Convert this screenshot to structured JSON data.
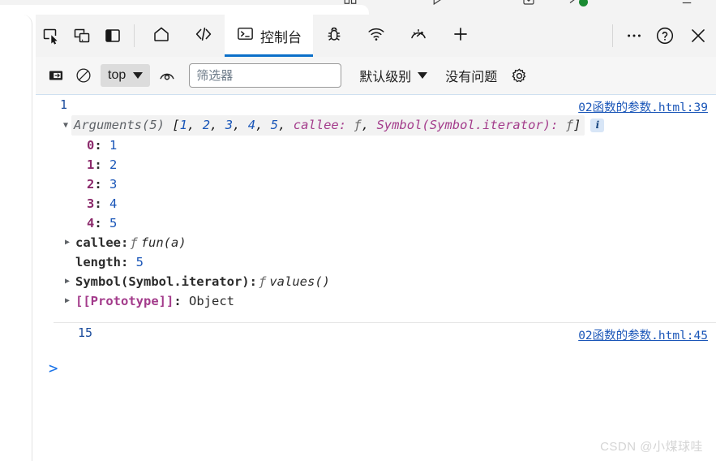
{
  "browser_chrome": {
    "icons": [
      "split-screen-icon",
      "play-icon",
      "download-icon",
      "extension-icon",
      "minimize-icon"
    ]
  },
  "devtools": {
    "toolbar_left_icons": [
      {
        "name": "inspect-element-icon"
      },
      {
        "name": "device-toolbar-icon"
      },
      {
        "name": "dock-side-icon"
      }
    ],
    "tabs": [
      {
        "name": "tab-home",
        "icon": "home-icon",
        "label": "",
        "active": false
      },
      {
        "name": "tab-sources",
        "icon": "code-icon",
        "label": "",
        "active": false
      },
      {
        "name": "tab-console",
        "icon": "console-icon",
        "label": "控制台",
        "active": true
      },
      {
        "name": "tab-debugger",
        "icon": "bug-icon",
        "label": "",
        "active": false
      },
      {
        "name": "tab-network",
        "icon": "network-icon",
        "label": "",
        "active": false
      },
      {
        "name": "tab-performance",
        "icon": "gauge-icon",
        "label": "",
        "active": false
      },
      {
        "name": "tab-add",
        "icon": "plus-icon",
        "label": "",
        "active": false
      }
    ],
    "toolbar_right_icons": [
      {
        "name": "more-options-icon"
      },
      {
        "name": "help-icon"
      },
      {
        "name": "close-icon"
      }
    ],
    "filterbar": {
      "sidebar_toggle": "console-sidebar-icon",
      "clear_console": "clear-console-icon",
      "context_selector": {
        "value": "top",
        "caret": "chevron-down-icon"
      },
      "eye_icon": "live-expression-icon",
      "filter_placeholder": "筛选器",
      "filter_value": "",
      "level_selector": {
        "value": "默认级别",
        "caret": "chevron-down-icon"
      },
      "issues_text": "没有问题",
      "settings_icon": "gear-icon"
    },
    "accent_color": "#0b6fc9",
    "link_color": "#1a56b8"
  },
  "console": {
    "entries": [
      {
        "line_number": "1",
        "source_link": "02函数的参数.html:39",
        "expanded": true,
        "summary": {
          "class_name": "Arguments(5)",
          "open_bracket": "[",
          "items": [
            "1",
            "2",
            "3",
            "4",
            "5"
          ],
          "callee_label": "callee:",
          "callee_fn": "ƒ",
          "symbol_label": "Symbol(Symbol.iterator):",
          "symbol_fn": "ƒ",
          "close_bracket": "]",
          "badge": "i"
        },
        "properties": [
          {
            "arrow": "blank",
            "key": "0",
            "key_style": "idx",
            "value": "1",
            "value_style": "num"
          },
          {
            "arrow": "blank",
            "key": "1",
            "key_style": "idx",
            "value": "2",
            "value_style": "num"
          },
          {
            "arrow": "blank",
            "key": "2",
            "key_style": "idx",
            "value": "3",
            "value_style": "num"
          },
          {
            "arrow": "blank",
            "key": "3",
            "key_style": "idx",
            "value": "4",
            "value_style": "num"
          },
          {
            "arrow": "blank",
            "key": "4",
            "key_style": "idx",
            "value": "5",
            "value_style": "num"
          },
          {
            "arrow": "closed",
            "key": "callee",
            "key_style": "dark",
            "fn_glyph": "ƒ",
            "value": "fun(a)",
            "value_style": "fn"
          },
          {
            "arrow": "blank",
            "key": "length",
            "key_style": "dark",
            "value": "5",
            "value_style": "num"
          },
          {
            "arrow": "closed",
            "key": "Symbol(Symbol.iterator)",
            "key_style": "dark",
            "fn_glyph": "ƒ",
            "value": "values()",
            "value_style": "fn"
          },
          {
            "arrow": "closed",
            "key": "[[Prototype]]",
            "key_style": "magenta",
            "value": "Object",
            "value_style": "obj"
          }
        ]
      },
      {
        "line_number": "15",
        "source_link": "02函数的参数.html:45",
        "expanded": false,
        "properties": []
      }
    ],
    "prompt_symbol": ">"
  },
  "watermark": "CSDN @小煤球哇"
}
